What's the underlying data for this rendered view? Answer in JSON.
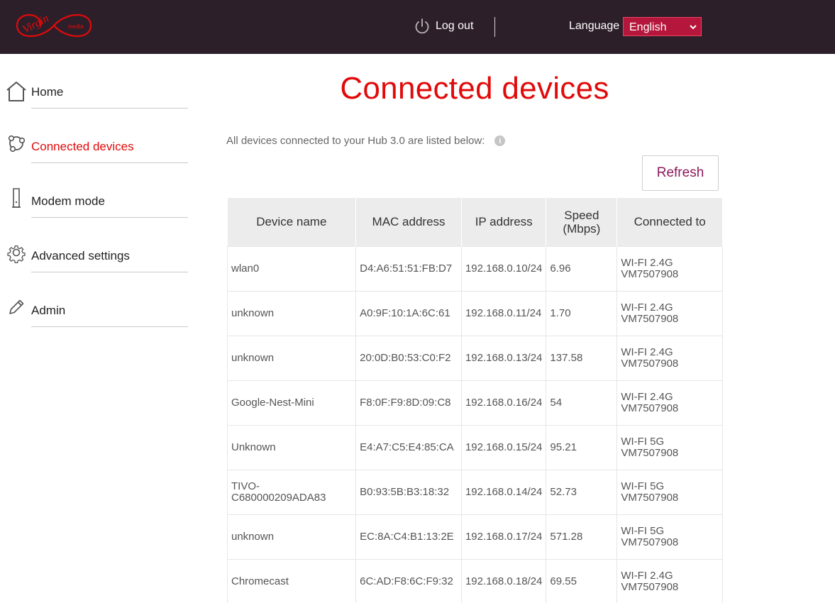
{
  "header": {
    "logo_text": "Virgin media",
    "logout_label": "Log out",
    "language_label": "Language",
    "language_selected": "English",
    "colors": {
      "background": "#2c1f29",
      "accent": "#e10a0a",
      "select_bg": "#b5163b"
    }
  },
  "sidebar": {
    "items": [
      {
        "label": "Home",
        "icon": "home-icon",
        "active": false
      },
      {
        "label": "Connected devices",
        "icon": "devices-icon",
        "active": true
      },
      {
        "label": "Modem mode",
        "icon": "modem-icon",
        "active": false
      },
      {
        "label": "Advanced settings",
        "icon": "gear-icon",
        "active": false
      },
      {
        "label": "Admin",
        "icon": "pencil-icon",
        "active": false
      }
    ]
  },
  "main": {
    "title": "Connected devices",
    "intro": "All devices connected to your Hub 3.0 are listed below:",
    "refresh_label": "Refresh",
    "table": {
      "headers": [
        "Device name",
        "MAC address",
        "IP address",
        "Speed (Mbps)",
        "Connected to"
      ],
      "rows": [
        {
          "name": "wlan0",
          "mac": "D4:A6:51:51:FB:D7",
          "ip": "192.168.0.10/24",
          "speed": "6.96",
          "conn": "WI-FI 2.4G VM7507908"
        },
        {
          "name": "unknown",
          "mac": "A0:9F:10:1A:6C:61",
          "ip": "192.168.0.11/24",
          "speed": "1.70",
          "conn": "WI-FI 2.4G VM7507908"
        },
        {
          "name": "unknown",
          "mac": "20:0D:B0:53:C0:F2",
          "ip": "192.168.0.13/24",
          "speed": "137.58",
          "conn": "WI-FI 2.4G VM7507908"
        },
        {
          "name": "Google-Nest-Mini",
          "mac": "F8:0F:F9:8D:09:C8",
          "ip": "192.168.0.16/24",
          "speed": "54",
          "conn": "WI-FI 2.4G VM7507908"
        },
        {
          "name": "Unknown",
          "mac": "E4:A7:C5:E4:85:CA",
          "ip": "192.168.0.15/24",
          "speed": "95.21",
          "conn": "WI-FI 5G VM7507908"
        },
        {
          "name": "TIVO-C680000209ADA83",
          "mac": "B0:93:5B:B3:18:32",
          "ip": "192.168.0.14/24",
          "speed": "52.73",
          "conn": "WI-FI 5G VM7507908"
        },
        {
          "name": "unknown",
          "mac": "EC:8A:C4:B1:13:2E",
          "ip": "192.168.0.17/24",
          "speed": "571.28",
          "conn": "WI-FI 5G VM7507908"
        },
        {
          "name": "Chromecast",
          "mac": "6C:AD:F8:6C:F9:32",
          "ip": "192.168.0.18/24",
          "speed": "69.55",
          "conn": "WI-FI 2.4G VM7507908"
        }
      ]
    }
  }
}
